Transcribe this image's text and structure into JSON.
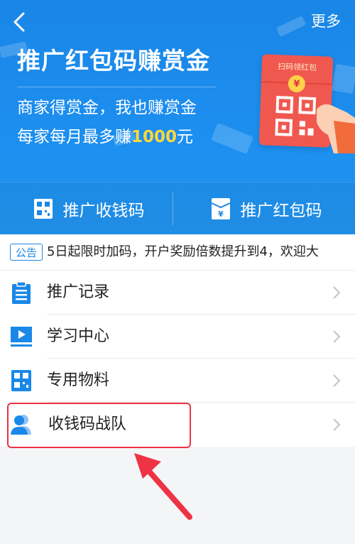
{
  "header": {
    "back_icon": "chevron-left-icon",
    "more_label": "更多",
    "title": "推广红包码赚赏金",
    "subtitle_line1": "商家得赏金，我也赚赏金",
    "subtitle_line2_prefix": "每家每月最多赚",
    "subtitle_line2_amount": "1000",
    "subtitle_line2_suffix": "元",
    "envelope_label": "扫码领红包",
    "envelope_coin": "¥"
  },
  "actions": [
    {
      "label": "推广收钱码",
      "icon": "qr-code-icon"
    },
    {
      "label": "推广红包码",
      "icon": "red-envelope-icon"
    }
  ],
  "notice": {
    "badge": "公告",
    "text": "5日起限时加码，开户奖励倍数提升到4，欢迎大"
  },
  "menu": [
    {
      "label": "推广记录",
      "icon": "clipboard-icon"
    },
    {
      "label": "学习中心",
      "icon": "video-play-icon"
    },
    {
      "label": "专用物料",
      "icon": "qr-code-icon"
    },
    {
      "label": "收钱码战队",
      "icon": "team-icon"
    }
  ],
  "colors": {
    "brand_blue": "#1a88e8",
    "highlight_yellow": "#ffd83a",
    "annotation_red": "#ee3344"
  }
}
